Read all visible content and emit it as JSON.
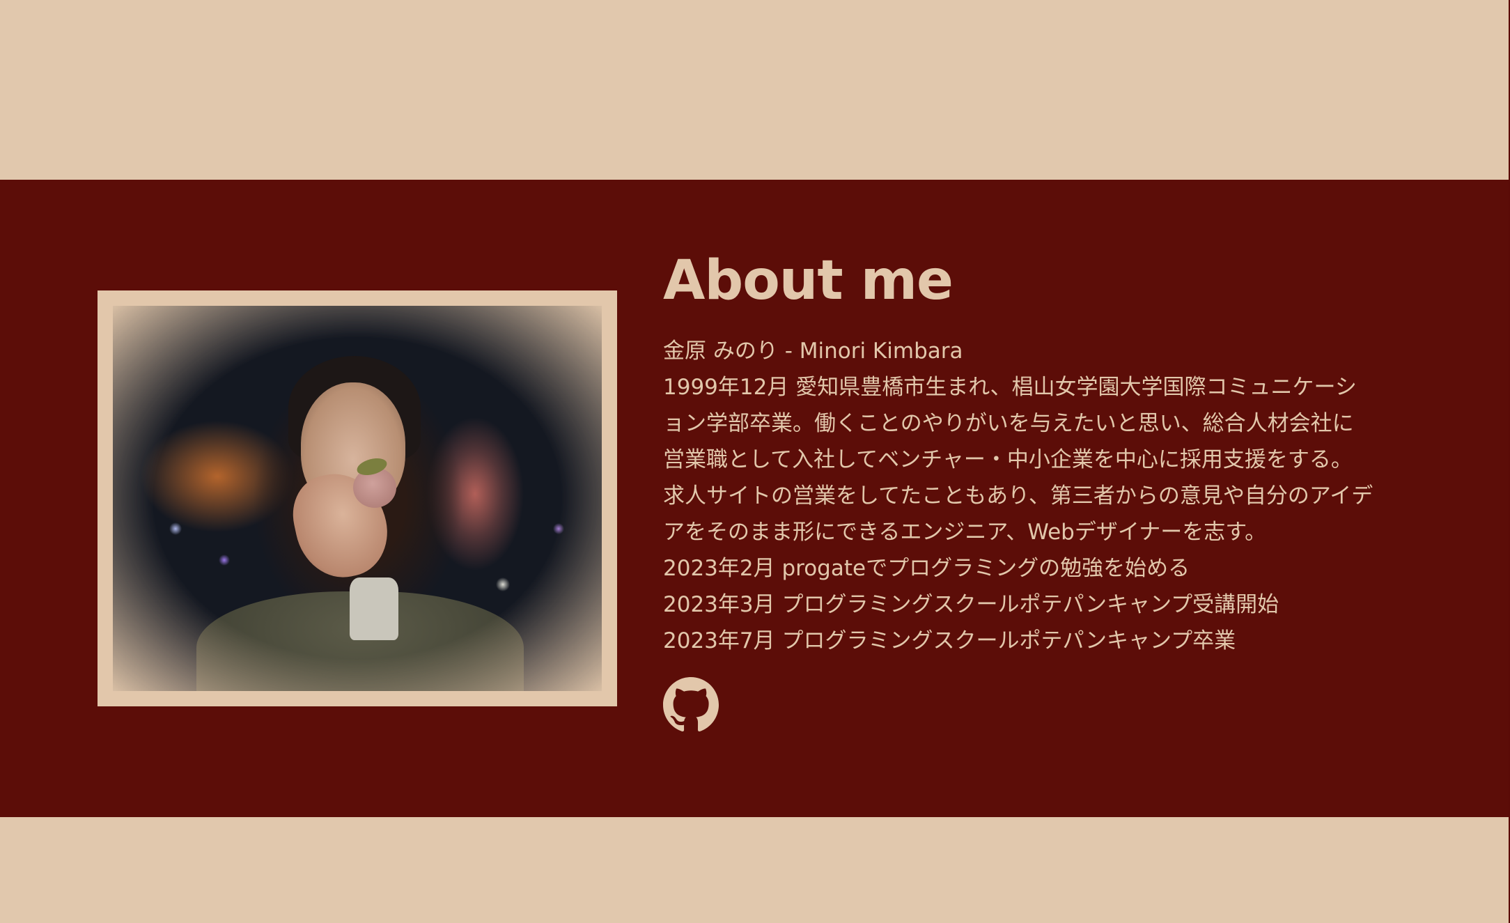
{
  "about": {
    "title": "About me",
    "lines": [
      "金原 みのり - Minori Kimbara",
      "1999年12月 愛知県豊橋市生まれ、椙山女学園大学国際コミュニケーシ",
      "ョン学部卒業。働くことのやりがいを与えたいと思い、総合人材会社に",
      "営業職として入社してベンチャー・中小企業を中心に採用支援をする。",
      "求人サイトの営業をしてたこともあり、第三者からの意見や自分のアイデ",
      "アをそのまま形にできるエンジニア、Webデザイナーを志す。",
      "2023年2月 progateでプログラミングの勉強を始める",
      "2023年3月 プログラミングスクールポテパンキャンプ受講開始",
      "2023年7月 プログラミングスクールポテパンキャンプ卒業"
    ],
    "github_icon": "github-icon"
  },
  "colors": {
    "page_background": "#e1c8ad",
    "band_background": "#5c0d08",
    "text": "#e2c7ab"
  }
}
